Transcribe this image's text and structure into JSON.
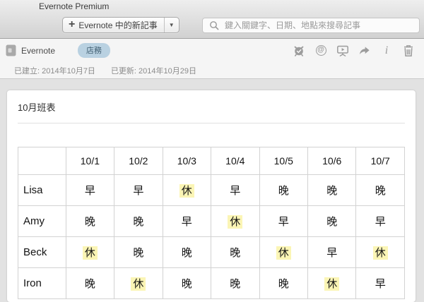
{
  "titlebar": {
    "title": "Evernote Premium"
  },
  "toolbar": {
    "plus": "+",
    "new_note_label": "Evernote 中的新記事",
    "dropdown_arrow": "▼",
    "search_placeholder": "鍵入關鍵字、日期、地點來搜尋記事"
  },
  "note_header": {
    "notebook_name": "Evernote",
    "tag": "店務",
    "icons": [
      "reminder-icon",
      "work-chat-icon",
      "present-icon",
      "share-icon",
      "info-icon",
      "trash-icon"
    ],
    "at_glyph": "@",
    "info_glyph": "i",
    "created": "已建立: 2014年10月7日",
    "updated": "已更新: 2014年10月29日"
  },
  "note": {
    "title": "10月班表",
    "table": {
      "columns": [
        "",
        "10/1",
        "10/2",
        "10/3",
        "10/4",
        "10/5",
        "10/6",
        "10/7"
      ],
      "rows": [
        {
          "name": "Lisa",
          "shifts": [
            {
              "t": "早",
              "hl": false
            },
            {
              "t": "早",
              "hl": false
            },
            {
              "t": "休",
              "hl": true
            },
            {
              "t": "早",
              "hl": false
            },
            {
              "t": "晚",
              "hl": false
            },
            {
              "t": "晚",
              "hl": false
            },
            {
              "t": "晚",
              "hl": false
            }
          ]
        },
        {
          "name": "Amy",
          "shifts": [
            {
              "t": "晚",
              "hl": false
            },
            {
              "t": "晚",
              "hl": false
            },
            {
              "t": "早",
              "hl": false
            },
            {
              "t": "休",
              "hl": true
            },
            {
              "t": "早",
              "hl": false
            },
            {
              "t": "晚",
              "hl": false
            },
            {
              "t": "早",
              "hl": false
            }
          ]
        },
        {
          "name": "Beck",
          "shifts": [
            {
              "t": "休",
              "hl": true
            },
            {
              "t": "晚",
              "hl": false
            },
            {
              "t": "晚",
              "hl": false
            },
            {
              "t": "晚",
              "hl": false
            },
            {
              "t": "休",
              "hl": true
            },
            {
              "t": "早",
              "hl": false
            },
            {
              "t": "休",
              "hl": true
            }
          ]
        },
        {
          "name": "Iron",
          "shifts": [
            {
              "t": "晚",
              "hl": false
            },
            {
              "t": "休",
              "hl": true
            },
            {
              "t": "晚",
              "hl": false
            },
            {
              "t": "晚",
              "hl": false
            },
            {
              "t": "晚",
              "hl": false
            },
            {
              "t": "休",
              "hl": true
            },
            {
              "t": "早",
              "hl": false
            }
          ]
        }
      ]
    }
  },
  "colors": {
    "highlight": "#fbf5b5",
    "tag_bg": "#b9d1e1",
    "tag_text": "#3f5d70",
    "icon_gray": "#9c9c9c"
  }
}
